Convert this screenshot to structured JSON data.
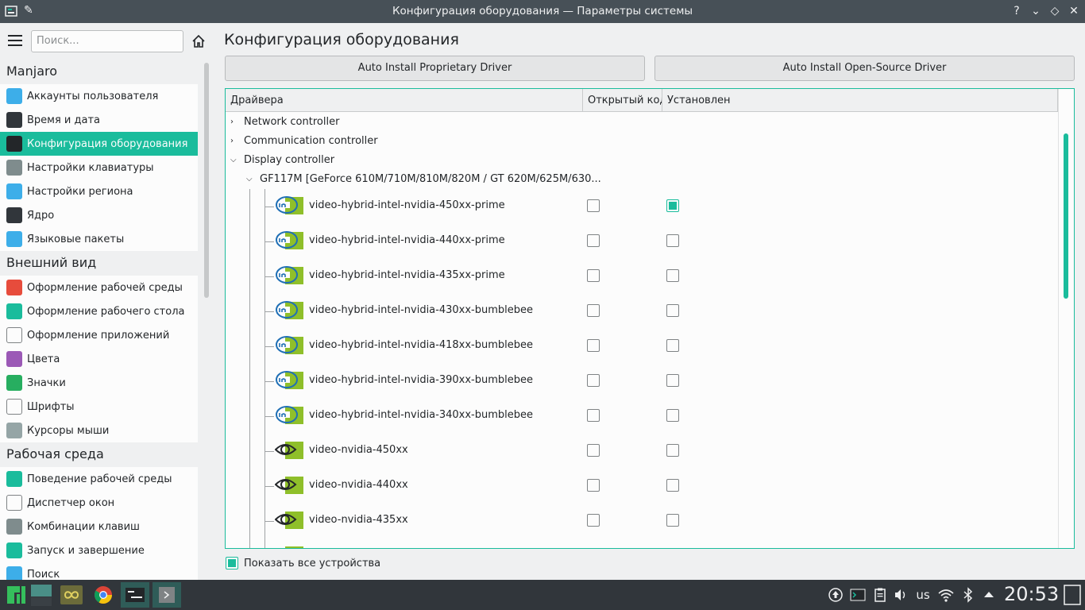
{
  "window": {
    "title": "Конфигурация оборудования — Параметры системы",
    "help": "?",
    "minimize": "⌄",
    "maximize": "◇",
    "close": "✕"
  },
  "sidebar": {
    "search_placeholder": "Поиск...",
    "groups": [
      {
        "label": "Manjaro",
        "items": [
          {
            "label": "Аккаунты пользователя",
            "icon": "user-account-icon",
            "color": "#3daee9"
          },
          {
            "label": "Время и дата",
            "icon": "clock-icon",
            "color": "#31363b"
          },
          {
            "label": "Конфигурация оборудования",
            "icon": "hardware-config-icon",
            "color": "#232629",
            "selected": true
          },
          {
            "label": "Настройки клавиатуры",
            "icon": "keyboard-icon",
            "color": "#7f8c8d"
          },
          {
            "label": "Настройки региона",
            "icon": "region-icon",
            "color": "#3daee9"
          },
          {
            "label": "Ядро",
            "icon": "kernel-icon",
            "color": "#31363b"
          },
          {
            "label": "Языковые пакеты",
            "icon": "language-pack-icon",
            "color": "#3daee9"
          }
        ]
      },
      {
        "label": "Внешний вид",
        "items": [
          {
            "label": "Оформление рабочей среды",
            "icon": "workspace-theme-icon",
            "color": "#e74c3c"
          },
          {
            "label": "Оформление рабочего стола",
            "icon": "desktop-theme-icon",
            "color": "#1abc9c"
          },
          {
            "label": "Оформление приложений",
            "icon": "app-style-icon",
            "color": "#fcfcfc"
          },
          {
            "label": "Цвета",
            "icon": "colors-icon",
            "color": "#9b59b6"
          },
          {
            "label": "Значки",
            "icon": "icons-icon",
            "color": "#27ae60"
          },
          {
            "label": "Шрифты",
            "icon": "fonts-icon",
            "color": "#fcfcfc"
          },
          {
            "label": "Курсоры мыши",
            "icon": "cursor-icon",
            "color": "#95a5a6"
          }
        ]
      },
      {
        "label": "Рабочая среда",
        "items": [
          {
            "label": "Поведение рабочей среды",
            "icon": "workspace-behavior-icon",
            "color": "#1abc9c"
          },
          {
            "label": "Диспетчер окон",
            "icon": "window-manager-icon",
            "color": "#fcfcfc"
          },
          {
            "label": "Комбинации клавиш",
            "icon": "shortcuts-icon",
            "color": "#7f8c8d"
          },
          {
            "label": "Запуск и завершение",
            "icon": "startup-icon",
            "color": "#1abc9c"
          },
          {
            "label": "Поиск",
            "icon": "search-settings-icon",
            "color": "#3daee9"
          }
        ]
      }
    ]
  },
  "main": {
    "title": "Конфигурация оборудования",
    "btn_proprietary": "Auto Install Proprietary Driver",
    "btn_opensource": "Auto Install Open-Source Driver",
    "columns": [
      "Драйвера",
      "Открытый код",
      "Установлен"
    ],
    "categories": [
      "Network controller",
      "Communication controller",
      "Display controller"
    ],
    "device": "GF117M [GeForce 610M/710M/810M/820M / GT 620M/625M/630...",
    "drivers": [
      {
        "name": "video-hybrid-intel-nvidia-450xx-prime",
        "open": false,
        "installed": true,
        "vendor": "intel"
      },
      {
        "name": "video-hybrid-intel-nvidia-440xx-prime",
        "open": false,
        "installed": false,
        "vendor": "intel"
      },
      {
        "name": "video-hybrid-intel-nvidia-435xx-prime",
        "open": false,
        "installed": false,
        "vendor": "intel"
      },
      {
        "name": "video-hybrid-intel-nvidia-430xx-bumblebee",
        "open": false,
        "installed": false,
        "vendor": "intel"
      },
      {
        "name": "video-hybrid-intel-nvidia-418xx-bumblebee",
        "open": false,
        "installed": false,
        "vendor": "intel"
      },
      {
        "name": "video-hybrid-intel-nvidia-390xx-bumblebee",
        "open": false,
        "installed": false,
        "vendor": "intel"
      },
      {
        "name": "video-hybrid-intel-nvidia-340xx-bumblebee",
        "open": false,
        "installed": false,
        "vendor": "intel"
      },
      {
        "name": "video-nvidia-450xx",
        "open": false,
        "installed": false,
        "vendor": "nvidia"
      },
      {
        "name": "video-nvidia-440xx",
        "open": false,
        "installed": false,
        "vendor": "nvidia"
      },
      {
        "name": "video-nvidia-435xx",
        "open": false,
        "installed": false,
        "vendor": "nvidia"
      }
    ],
    "show_all_label": "Показать все устройства",
    "show_all_checked": true
  },
  "taskbar": {
    "keyboard_layout": "us",
    "clock": "20:53"
  }
}
